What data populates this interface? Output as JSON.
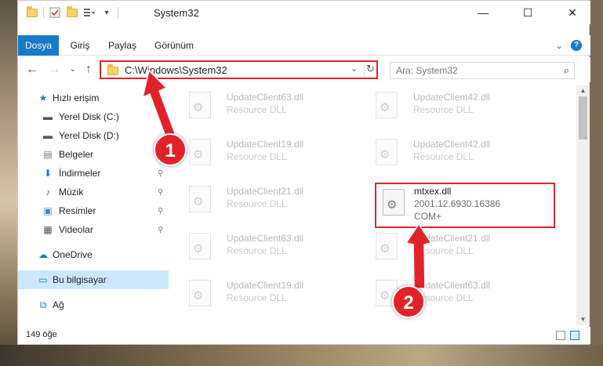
{
  "window": {
    "title": "System32",
    "buttons": {
      "minimize": "—",
      "maximize": "☐",
      "close": "✕"
    }
  },
  "ribbon": {
    "tabs": [
      "Dosya",
      "Giriş",
      "Paylaş",
      "Görünüm"
    ],
    "active_tab": "Dosya",
    "expand_icon": "⌄",
    "help_icon": "?"
  },
  "nav": {
    "back_icon": "←",
    "forward_icon": "→",
    "recent_icon": "⌄",
    "up_icon": "↑",
    "address": "C:\\Windows\\System32",
    "address_dropdown_icon": "⌄",
    "refresh_icon": "↻",
    "search_placeholder": "Ara: System32",
    "search_icon": "⌕"
  },
  "sidebar": {
    "items": [
      {
        "label": "Hızlı erişim",
        "icon": "★",
        "pinned": false
      },
      {
        "label": "Yerel Disk (C:)",
        "icon": "▬",
        "pinned": true
      },
      {
        "label": "Yerel Disk (D:)",
        "icon": "▬",
        "pinned": false
      },
      {
        "label": "Belgeler",
        "icon": "▤",
        "pinned": false
      },
      {
        "label": "İndirmeler",
        "icon": "⬇",
        "pinned": true
      },
      {
        "label": "Müzik",
        "icon": "♪",
        "pinned": true
      },
      {
        "label": "Resimler",
        "icon": "▣",
        "pinned": true
      },
      {
        "label": "Videolar",
        "icon": "▦",
        "pinned": true
      },
      {
        "label": "OneDrive",
        "icon": "☁",
        "pinned": false
      },
      {
        "label": "Bu bilgisayar",
        "icon": "▭",
        "pinned": false,
        "selected": true
      },
      {
        "label": "Ağ",
        "icon": "⧉",
        "pinned": false
      }
    ],
    "pin_icon": "📌"
  },
  "files": [
    {
      "name": "UpdateClient63.dll",
      "desc": "Resource DLL"
    },
    {
      "name": "UpdateClient42.dll",
      "desc": "Resource DLL"
    },
    {
      "name": "UpdateClient19.dll",
      "desc": "Resource DLL"
    },
    {
      "name": "UpdateClient42.dll",
      "desc": "Resource DLL"
    },
    {
      "name": "UpdateClient21.dll",
      "desc": "Resource DLL"
    },
    {
      "name": "mtxex.dll",
      "desc": "2001.12.6930.16386",
      "desc2": "COM+",
      "highlighted": true
    },
    {
      "name": "UpdateClient63.dll",
      "desc": "Resource DLL"
    },
    {
      "name": "UpdateClient21.dll",
      "desc": "Resource DLL"
    },
    {
      "name": "UpdateClient19.dll",
      "desc": "Resource DLL"
    },
    {
      "name": "UpdateClient63.dll",
      "desc": "Resource DLL"
    }
  ],
  "status": {
    "item_count": "149 öğe"
  },
  "callouts": [
    "1",
    "2"
  ],
  "colors": {
    "accent": "#1979ca",
    "highlight": "#e2222a",
    "selected_bg": "#cce8ff"
  }
}
